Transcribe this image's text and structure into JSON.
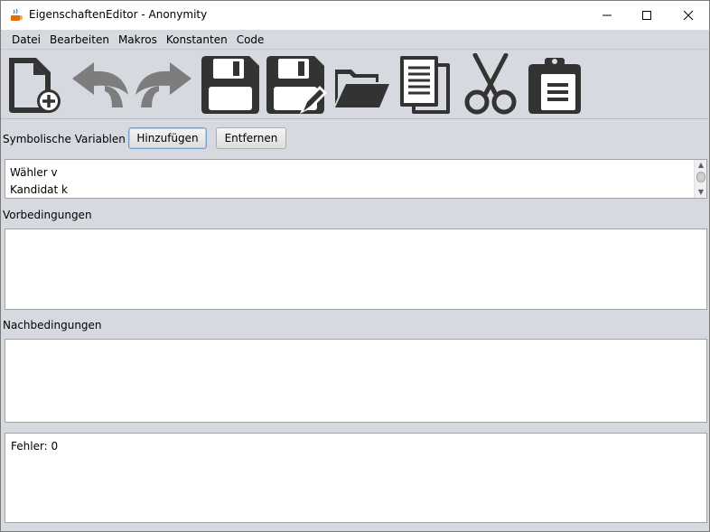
{
  "window": {
    "title": "EigenschaftenEditor - Anonymity"
  },
  "menu": {
    "items": [
      "Datei",
      "Bearbeiten",
      "Makros",
      "Konstanten",
      "Code"
    ]
  },
  "toolbar": {
    "icons": [
      "new-file-icon",
      "undo-icon",
      "redo-icon",
      "save-icon",
      "save-as-icon",
      "open-folder-icon",
      "copy-icon",
      "cut-icon",
      "paste-icon"
    ],
    "colors": {
      "dark": "#333333",
      "disabled": "#7d7d7d"
    }
  },
  "symbolic": {
    "label": "Symbolische Variablen",
    "add_label": "Hinzufügen",
    "remove_label": "Entfernen",
    "variables": [
      "Wähler v",
      "Kandidat k"
    ]
  },
  "preconditions": {
    "label": "Vorbedingungen",
    "text": ""
  },
  "postconditions": {
    "label": "Nachbedingungen",
    "text": ""
  },
  "errors": {
    "text": "Fehler: 0"
  }
}
